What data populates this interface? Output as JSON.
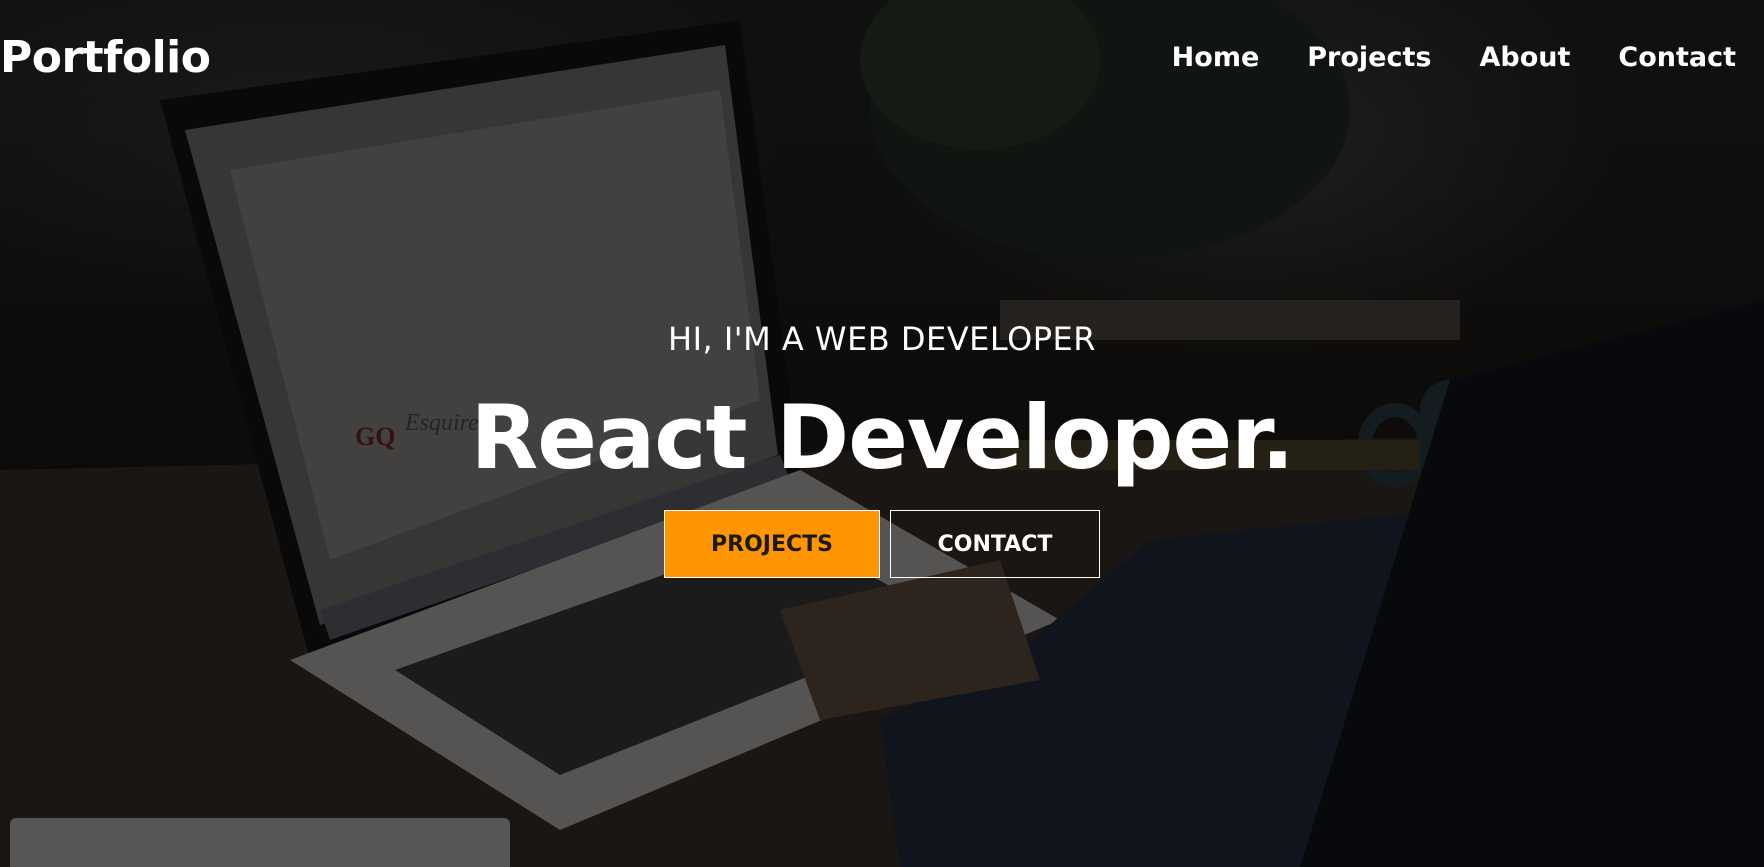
{
  "nav": {
    "brand": "Portfolio",
    "links": [
      "Home",
      "Projects",
      "About",
      "Contact"
    ]
  },
  "hero": {
    "subtitle": "HI, I'M A WEB DEVELOPER",
    "headline": "React Developer.",
    "primary_button": "PROJECTS",
    "secondary_button": "CONTACT"
  },
  "colors": {
    "accent": "#ff9500",
    "text": "#ffffff",
    "overlay": "#000000"
  }
}
